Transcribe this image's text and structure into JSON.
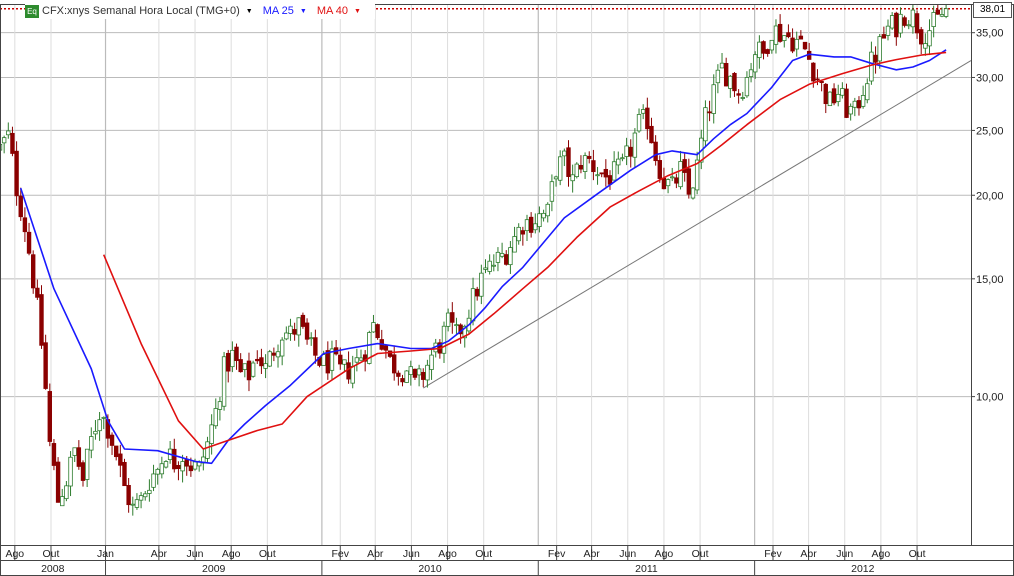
{
  "legend": {
    "badge": "Eq",
    "instrument": "CFX:xnys Semanal Hora Local (TMG+0)",
    "caret": "▼",
    "ma25_label": "MA 25",
    "ma40_label": "MA 40"
  },
  "last_price": "38,01",
  "colors": {
    "candle_up": "#2e7d2e",
    "candle_down": "#8b0000",
    "ma25": "#1a1aff",
    "ma40": "#e01010",
    "trendline": "#777777",
    "grid": "#bbbbbb",
    "last_price_line": "#cc0000"
  },
  "chart_data": {
    "type": "line",
    "title": "",
    "scale": "log",
    "ylim": [
      6.0,
      38.5
    ],
    "yticks": [
      {
        "value": 10,
        "label": "10,00"
      },
      {
        "value": 15,
        "label": "15,00"
      },
      {
        "value": 20,
        "label": "20,00"
      },
      {
        "value": 25,
        "label": "25,00"
      },
      {
        "value": 30,
        "label": "30,00"
      },
      {
        "value": 35,
        "label": "35,00"
      }
    ],
    "x_range": [
      "2008-07-07",
      "2012-12-31"
    ],
    "month_ticks": [
      {
        "date": "2008-08-01",
        "label": "Ago"
      },
      {
        "date": "2008-10-01",
        "label": "Out"
      },
      {
        "date": "2009-01-01",
        "label": "Jan"
      },
      {
        "date": "2009-04-01",
        "label": "Abr"
      },
      {
        "date": "2009-06-01",
        "label": "Jun"
      },
      {
        "date": "2009-08-01",
        "label": "Ago"
      },
      {
        "date": "2009-10-01",
        "label": "Out"
      },
      {
        "date": "2010-02-01",
        "label": "Fev"
      },
      {
        "date": "2010-04-01",
        "label": "Abr"
      },
      {
        "date": "2010-06-01",
        "label": "Jun"
      },
      {
        "date": "2010-08-01",
        "label": "Ago"
      },
      {
        "date": "2010-10-01",
        "label": "Out"
      },
      {
        "date": "2011-02-01",
        "label": "Fev"
      },
      {
        "date": "2011-04-01",
        "label": "Abr"
      },
      {
        "date": "2011-06-01",
        "label": "Jun"
      },
      {
        "date": "2011-08-01",
        "label": "Ago"
      },
      {
        "date": "2011-10-01",
        "label": "Out"
      },
      {
        "date": "2012-02-01",
        "label": "Fev"
      },
      {
        "date": "2012-04-01",
        "label": "Abr"
      },
      {
        "date": "2012-06-01",
        "label": "Jun"
      },
      {
        "date": "2012-08-01",
        "label": "Ago"
      },
      {
        "date": "2012-10-01",
        "label": "Out"
      }
    ],
    "year_ticks": [
      {
        "date": "2008-01-01",
        "label": "2008"
      },
      {
        "date": "2009-01-01",
        "label": "2009"
      },
      {
        "date": "2010-01-01",
        "label": "2010"
      },
      {
        "date": "2011-01-01",
        "label": "2011"
      },
      {
        "date": "2012-01-01",
        "label": "2012"
      }
    ],
    "price_path": [
      [
        "2008-07-07",
        23.5
      ],
      [
        "2008-07-21",
        24.5
      ],
      [
        "2008-08-04",
        20.5
      ],
      [
        "2008-08-18",
        18.0
      ],
      [
        "2008-09-01",
        15.0
      ],
      [
        "2008-09-15",
        12.0
      ],
      [
        "2008-09-29",
        8.5
      ],
      [
        "2008-10-13",
        7.0
      ],
      [
        "2008-10-27",
        7.5
      ],
      [
        "2008-11-10",
        8.3
      ],
      [
        "2008-11-24",
        7.5
      ],
      [
        "2008-12-08",
        8.6
      ],
      [
        "2008-12-22",
        9.5
      ],
      [
        "2009-01-05",
        9.0
      ],
      [
        "2009-01-19",
        8.2
      ],
      [
        "2009-02-02",
        7.3
      ],
      [
        "2009-02-16",
        6.8
      ],
      [
        "2009-03-02",
        7.0
      ],
      [
        "2009-03-16",
        7.5
      ],
      [
        "2009-03-30",
        7.8
      ],
      [
        "2009-04-13",
        8.3
      ],
      [
        "2009-04-27",
        8.0
      ],
      [
        "2009-05-11",
        8.2
      ],
      [
        "2009-05-25",
        7.9
      ],
      [
        "2009-06-08",
        7.8
      ],
      [
        "2009-06-22",
        8.5
      ],
      [
        "2009-07-06",
        9.5
      ],
      [
        "2009-07-20",
        11.0
      ],
      [
        "2009-08-03",
        11.5
      ],
      [
        "2009-08-17",
        10.8
      ],
      [
        "2009-08-31",
        10.8
      ],
      [
        "2009-09-14",
        11.6
      ],
      [
        "2009-09-28",
        11.0
      ],
      [
        "2009-10-12",
        11.8
      ],
      [
        "2009-10-26",
        12.5
      ],
      [
        "2009-11-09",
        12.4
      ],
      [
        "2009-11-23",
        12.8
      ],
      [
        "2009-12-07",
        12.0
      ],
      [
        "2009-12-21",
        11.5
      ],
      [
        "2010-01-04",
        11.2
      ],
      [
        "2010-01-18",
        11.3
      ],
      [
        "2010-02-01",
        10.9
      ],
      [
        "2010-02-15",
        11.0
      ],
      [
        "2010-03-01",
        11.3
      ],
      [
        "2010-03-15",
        11.8
      ],
      [
        "2010-03-29",
        12.8
      ],
      [
        "2010-04-12",
        12.2
      ],
      [
        "2010-04-26",
        11.3
      ],
      [
        "2010-05-10",
        11.0
      ],
      [
        "2010-05-24",
        11.0
      ],
      [
        "2010-06-07",
        10.4
      ],
      [
        "2010-06-21",
        10.8
      ],
      [
        "2010-07-05",
        11.5
      ],
      [
        "2010-07-19",
        12.0
      ],
      [
        "2010-08-02",
        12.8
      ],
      [
        "2010-08-16",
        12.3
      ],
      [
        "2010-08-30",
        13.0
      ],
      [
        "2010-09-13",
        14.0
      ],
      [
        "2010-09-27",
        15.0
      ],
      [
        "2010-10-11",
        15.6
      ],
      [
        "2010-10-25",
        16.0
      ],
      [
        "2010-11-08",
        16.5
      ],
      [
        "2010-11-22",
        17.3
      ],
      [
        "2010-12-06",
        18.2
      ],
      [
        "2010-12-20",
        18.3
      ],
      [
        "2011-01-03",
        18.6
      ],
      [
        "2011-01-17",
        18.8
      ],
      [
        "2011-01-31",
        22.0
      ],
      [
        "2011-02-14",
        22.5
      ],
      [
        "2011-02-28",
        21.0
      ],
      [
        "2011-03-14",
        22.5
      ],
      [
        "2011-03-28",
        22.5
      ],
      [
        "2011-04-11",
        21.8
      ],
      [
        "2011-04-25",
        21.3
      ],
      [
        "2011-05-09",
        21.5
      ],
      [
        "2011-05-23",
        22.0
      ],
      [
        "2011-06-06",
        23.5
      ],
      [
        "2011-06-20",
        25.5
      ],
      [
        "2011-07-04",
        26.0
      ],
      [
        "2011-07-18",
        23.0
      ],
      [
        "2011-08-01",
        21.0
      ],
      [
        "2011-08-15",
        20.5
      ],
      [
        "2011-08-29",
        21.8
      ],
      [
        "2011-09-12",
        20.0
      ],
      [
        "2011-09-26",
        22.0
      ],
      [
        "2011-10-10",
        26.0
      ],
      [
        "2011-10-24",
        28.5
      ],
      [
        "2011-11-07",
        31.0
      ],
      [
        "2011-11-21",
        30.0
      ],
      [
        "2011-12-05",
        28.5
      ],
      [
        "2011-12-19",
        30.0
      ],
      [
        "2012-01-02",
        33.0
      ],
      [
        "2012-01-16",
        32.5
      ],
      [
        "2012-01-30",
        35.5
      ],
      [
        "2012-02-13",
        35.0
      ],
      [
        "2012-02-27",
        34.5
      ],
      [
        "2012-03-12",
        34.0
      ],
      [
        "2012-03-26",
        33.0
      ],
      [
        "2012-04-09",
        31.0
      ],
      [
        "2012-04-23",
        29.0
      ],
      [
        "2012-05-07",
        27.5
      ],
      [
        "2012-05-21",
        28.5
      ],
      [
        "2012-06-04",
        27.0
      ],
      [
        "2012-06-18",
        26.5
      ],
      [
        "2012-07-02",
        29.0
      ],
      [
        "2012-07-16",
        31.5
      ],
      [
        "2012-07-30",
        33.5
      ],
      [
        "2012-08-13",
        35.5
      ],
      [
        "2012-08-27",
        36.0
      ],
      [
        "2012-09-10",
        37.5
      ],
      [
        "2012-09-24",
        37.0
      ],
      [
        "2012-10-08",
        35.0
      ],
      [
        "2012-10-22",
        35.5
      ],
      [
        "2012-11-05",
        36.5
      ],
      [
        "2012-11-19",
        38.0
      ]
    ],
    "series": [
      {
        "name": "MA 25",
        "values": [
          [
            "2008-08-11",
            20.5
          ],
          [
            "2008-10-06",
            14.5
          ],
          [
            "2008-12-08",
            11.0
          ],
          [
            "2009-01-05",
            9.2
          ],
          [
            "2009-02-02",
            8.35
          ],
          [
            "2009-03-30",
            8.3
          ],
          [
            "2009-06-01",
            8.0
          ],
          [
            "2009-06-29",
            7.95
          ],
          [
            "2009-07-27",
            8.6
          ],
          [
            "2009-08-24",
            9.1
          ],
          [
            "2009-09-28",
            9.7
          ],
          [
            "2009-11-09",
            10.4
          ],
          [
            "2010-01-04",
            11.6
          ],
          [
            "2010-02-15",
            11.8
          ],
          [
            "2010-04-05",
            12.0
          ],
          [
            "2010-05-31",
            11.8
          ],
          [
            "2010-07-05",
            11.8
          ],
          [
            "2010-08-02",
            12.1
          ],
          [
            "2010-09-06",
            12.8
          ],
          [
            "2010-10-04",
            13.6
          ],
          [
            "2010-11-01",
            14.6
          ],
          [
            "2010-12-06",
            15.6
          ],
          [
            "2011-01-10",
            17.0
          ],
          [
            "2011-02-14",
            18.5
          ],
          [
            "2011-04-11",
            20.1
          ],
          [
            "2011-06-06",
            21.8
          ],
          [
            "2011-07-18",
            23.0
          ],
          [
            "2011-08-15",
            23.3
          ],
          [
            "2011-09-26",
            23.0
          ],
          [
            "2011-10-24",
            24.3
          ],
          [
            "2011-11-21",
            25.5
          ],
          [
            "2011-12-19",
            26.5
          ],
          [
            "2012-01-30",
            29.0
          ],
          [
            "2012-03-05",
            31.8
          ],
          [
            "2012-04-02",
            32.5
          ],
          [
            "2012-05-14",
            32.2
          ],
          [
            "2012-06-11",
            32.2
          ],
          [
            "2012-07-16",
            31.5
          ],
          [
            "2012-08-27",
            30.8
          ],
          [
            "2012-09-24",
            31.1
          ],
          [
            "2012-10-22",
            31.8
          ],
          [
            "2012-11-19",
            33.0
          ]
        ]
      },
      {
        "name": "MA 40",
        "values": [
          [
            "2008-12-29",
            16.3
          ],
          [
            "2009-03-02",
            12.0
          ],
          [
            "2009-05-04",
            9.2
          ],
          [
            "2009-06-15",
            8.35
          ],
          [
            "2009-07-27",
            8.6
          ],
          [
            "2009-09-14",
            8.9
          ],
          [
            "2009-10-26",
            9.1
          ],
          [
            "2009-12-07",
            10.0
          ],
          [
            "2010-02-15",
            11.0
          ],
          [
            "2010-04-05",
            11.6
          ],
          [
            "2010-05-31",
            11.7
          ],
          [
            "2010-07-19",
            11.8
          ],
          [
            "2010-09-06",
            12.4
          ],
          [
            "2010-10-18",
            13.3
          ],
          [
            "2010-12-06",
            14.5
          ],
          [
            "2011-01-17",
            15.6
          ],
          [
            "2011-03-07",
            17.3
          ],
          [
            "2011-05-02",
            19.2
          ],
          [
            "2011-06-20",
            20.3
          ],
          [
            "2011-08-08",
            21.4
          ],
          [
            "2011-09-26",
            22.3
          ],
          [
            "2011-11-07",
            23.8
          ],
          [
            "2011-12-19",
            25.5
          ],
          [
            "2012-02-13",
            27.8
          ],
          [
            "2012-04-02",
            29.3
          ],
          [
            "2012-05-28",
            30.4
          ],
          [
            "2012-07-16",
            31.3
          ],
          [
            "2012-08-27",
            31.9
          ],
          [
            "2012-10-08",
            32.4
          ],
          [
            "2012-11-19",
            32.7
          ]
        ]
      }
    ],
    "trendline": {
      "start": [
        "2010-06-21",
        10.3
      ],
      "end": [
        "2012-12-31",
        31.8
      ]
    },
    "last_value": 38.01,
    "grid": true
  }
}
